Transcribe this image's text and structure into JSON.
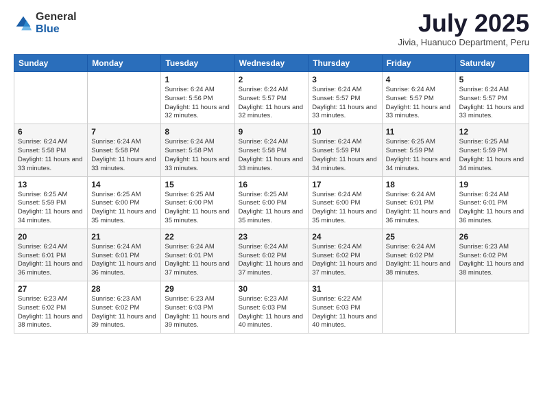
{
  "header": {
    "logo_general": "General",
    "logo_blue": "Blue",
    "month_title": "July 2025",
    "location": "Jivia, Huanuco Department, Peru"
  },
  "calendar": {
    "days_of_week": [
      "Sunday",
      "Monday",
      "Tuesday",
      "Wednesday",
      "Thursday",
      "Friday",
      "Saturday"
    ],
    "weeks": [
      [
        {
          "day": "",
          "sunrise": "",
          "sunset": "",
          "daylight": ""
        },
        {
          "day": "",
          "sunrise": "",
          "sunset": "",
          "daylight": ""
        },
        {
          "day": "1",
          "sunrise": "Sunrise: 6:24 AM",
          "sunset": "Sunset: 5:56 PM",
          "daylight": "Daylight: 11 hours and 32 minutes."
        },
        {
          "day": "2",
          "sunrise": "Sunrise: 6:24 AM",
          "sunset": "Sunset: 5:57 PM",
          "daylight": "Daylight: 11 hours and 32 minutes."
        },
        {
          "day": "3",
          "sunrise": "Sunrise: 6:24 AM",
          "sunset": "Sunset: 5:57 PM",
          "daylight": "Daylight: 11 hours and 33 minutes."
        },
        {
          "day": "4",
          "sunrise": "Sunrise: 6:24 AM",
          "sunset": "Sunset: 5:57 PM",
          "daylight": "Daylight: 11 hours and 33 minutes."
        },
        {
          "day": "5",
          "sunrise": "Sunrise: 6:24 AM",
          "sunset": "Sunset: 5:57 PM",
          "daylight": "Daylight: 11 hours and 33 minutes."
        }
      ],
      [
        {
          "day": "6",
          "sunrise": "Sunrise: 6:24 AM",
          "sunset": "Sunset: 5:58 PM",
          "daylight": "Daylight: 11 hours and 33 minutes."
        },
        {
          "day": "7",
          "sunrise": "Sunrise: 6:24 AM",
          "sunset": "Sunset: 5:58 PM",
          "daylight": "Daylight: 11 hours and 33 minutes."
        },
        {
          "day": "8",
          "sunrise": "Sunrise: 6:24 AM",
          "sunset": "Sunset: 5:58 PM",
          "daylight": "Daylight: 11 hours and 33 minutes."
        },
        {
          "day": "9",
          "sunrise": "Sunrise: 6:24 AM",
          "sunset": "Sunset: 5:58 PM",
          "daylight": "Daylight: 11 hours and 33 minutes."
        },
        {
          "day": "10",
          "sunrise": "Sunrise: 6:24 AM",
          "sunset": "Sunset: 5:59 PM",
          "daylight": "Daylight: 11 hours and 34 minutes."
        },
        {
          "day": "11",
          "sunrise": "Sunrise: 6:25 AM",
          "sunset": "Sunset: 5:59 PM",
          "daylight": "Daylight: 11 hours and 34 minutes."
        },
        {
          "day": "12",
          "sunrise": "Sunrise: 6:25 AM",
          "sunset": "Sunset: 5:59 PM",
          "daylight": "Daylight: 11 hours and 34 minutes."
        }
      ],
      [
        {
          "day": "13",
          "sunrise": "Sunrise: 6:25 AM",
          "sunset": "Sunset: 5:59 PM",
          "daylight": "Daylight: 11 hours and 34 minutes."
        },
        {
          "day": "14",
          "sunrise": "Sunrise: 6:25 AM",
          "sunset": "Sunset: 6:00 PM",
          "daylight": "Daylight: 11 hours and 35 minutes."
        },
        {
          "day": "15",
          "sunrise": "Sunrise: 6:25 AM",
          "sunset": "Sunset: 6:00 PM",
          "daylight": "Daylight: 11 hours and 35 minutes."
        },
        {
          "day": "16",
          "sunrise": "Sunrise: 6:25 AM",
          "sunset": "Sunset: 6:00 PM",
          "daylight": "Daylight: 11 hours and 35 minutes."
        },
        {
          "day": "17",
          "sunrise": "Sunrise: 6:24 AM",
          "sunset": "Sunset: 6:00 PM",
          "daylight": "Daylight: 11 hours and 35 minutes."
        },
        {
          "day": "18",
          "sunrise": "Sunrise: 6:24 AM",
          "sunset": "Sunset: 6:01 PM",
          "daylight": "Daylight: 11 hours and 36 minutes."
        },
        {
          "day": "19",
          "sunrise": "Sunrise: 6:24 AM",
          "sunset": "Sunset: 6:01 PM",
          "daylight": "Daylight: 11 hours and 36 minutes."
        }
      ],
      [
        {
          "day": "20",
          "sunrise": "Sunrise: 6:24 AM",
          "sunset": "Sunset: 6:01 PM",
          "daylight": "Daylight: 11 hours and 36 minutes."
        },
        {
          "day": "21",
          "sunrise": "Sunrise: 6:24 AM",
          "sunset": "Sunset: 6:01 PM",
          "daylight": "Daylight: 11 hours and 36 minutes."
        },
        {
          "day": "22",
          "sunrise": "Sunrise: 6:24 AM",
          "sunset": "Sunset: 6:01 PM",
          "daylight": "Daylight: 11 hours and 37 minutes."
        },
        {
          "day": "23",
          "sunrise": "Sunrise: 6:24 AM",
          "sunset": "Sunset: 6:02 PM",
          "daylight": "Daylight: 11 hours and 37 minutes."
        },
        {
          "day": "24",
          "sunrise": "Sunrise: 6:24 AM",
          "sunset": "Sunset: 6:02 PM",
          "daylight": "Daylight: 11 hours and 37 minutes."
        },
        {
          "day": "25",
          "sunrise": "Sunrise: 6:24 AM",
          "sunset": "Sunset: 6:02 PM",
          "daylight": "Daylight: 11 hours and 38 minutes."
        },
        {
          "day": "26",
          "sunrise": "Sunrise: 6:23 AM",
          "sunset": "Sunset: 6:02 PM",
          "daylight": "Daylight: 11 hours and 38 minutes."
        }
      ],
      [
        {
          "day": "27",
          "sunrise": "Sunrise: 6:23 AM",
          "sunset": "Sunset: 6:02 PM",
          "daylight": "Daylight: 11 hours and 38 minutes."
        },
        {
          "day": "28",
          "sunrise": "Sunrise: 6:23 AM",
          "sunset": "Sunset: 6:02 PM",
          "daylight": "Daylight: 11 hours and 39 minutes."
        },
        {
          "day": "29",
          "sunrise": "Sunrise: 6:23 AM",
          "sunset": "Sunset: 6:03 PM",
          "daylight": "Daylight: 11 hours and 39 minutes."
        },
        {
          "day": "30",
          "sunrise": "Sunrise: 6:23 AM",
          "sunset": "Sunset: 6:03 PM",
          "daylight": "Daylight: 11 hours and 40 minutes."
        },
        {
          "day": "31",
          "sunrise": "Sunrise: 6:22 AM",
          "sunset": "Sunset: 6:03 PM",
          "daylight": "Daylight: 11 hours and 40 minutes."
        },
        {
          "day": "",
          "sunrise": "",
          "sunset": "",
          "daylight": ""
        },
        {
          "day": "",
          "sunrise": "",
          "sunset": "",
          "daylight": ""
        }
      ]
    ]
  }
}
